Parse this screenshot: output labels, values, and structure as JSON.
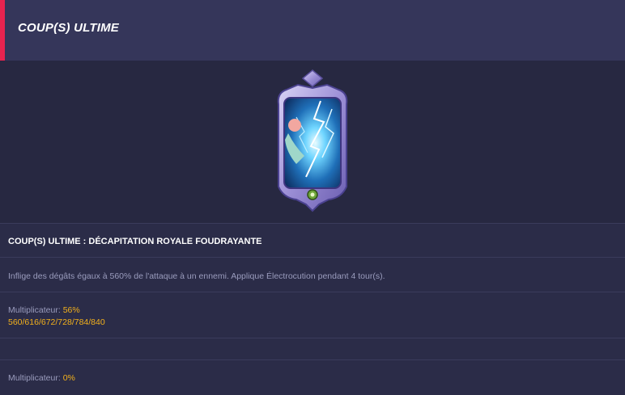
{
  "header": {
    "title": "COUP(S) ULTIME"
  },
  "skill": {
    "title": "COUP(S) ULTIME : DÉCAPITATION ROYALE FOUDRAYANTE",
    "description": "Inflige des dégâts égaux à 560% de l'attaque à un ennemi. Applique Électrocution pendant 4 tour(s).",
    "multiplier_label": "Multiplicateur: ",
    "multiplier_value": "56%",
    "levels": "560/616/672/728/784/840",
    "multiplier2_label": "Multiplicateur: ",
    "multiplier2_value": "0%"
  },
  "colors": {
    "accent": "#e8234f",
    "highlight": "#f3b11c",
    "background": "#272841",
    "header": "#35365a"
  },
  "icons": {
    "card": "skill-card-lightning-icon"
  }
}
